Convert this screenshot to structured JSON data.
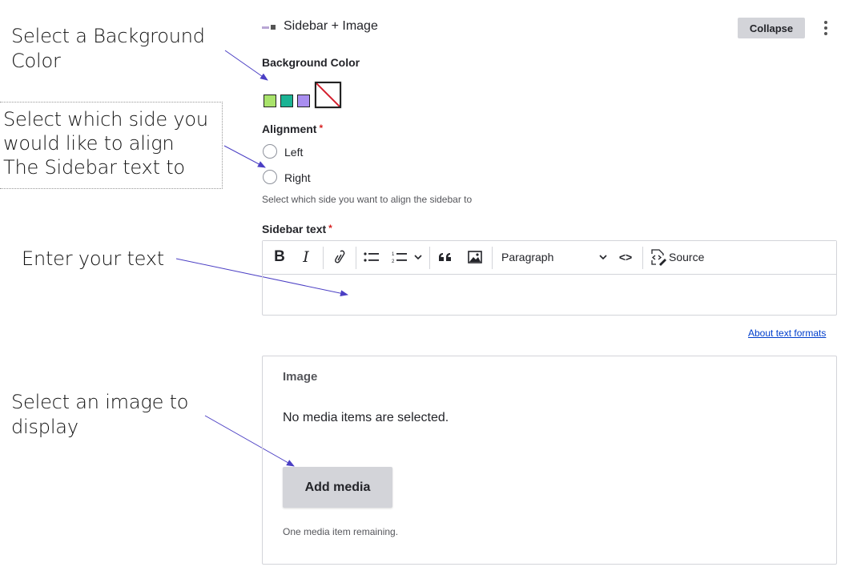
{
  "annotations": {
    "background_color": [
      "Select a Background",
      "Color"
    ],
    "alignment": [
      "Select which side you",
      "would like to align",
      "The Sidebar text to"
    ],
    "text": "Enter your text",
    "image": [
      "Select an image to",
      "display"
    ],
    "arrow_color": "#4b3fc4"
  },
  "header": {
    "icon": "paragraph-type-icon",
    "title": "Sidebar + Image",
    "collapse_label": "Collapse",
    "more_icon": "kebab-menu-icon"
  },
  "background_color": {
    "label": "Background Color",
    "swatches": [
      {
        "name": "light-green",
        "color": "#a9e36b"
      },
      {
        "name": "teal",
        "color": "#1bb394"
      },
      {
        "name": "lavender",
        "color": "#a98ef0"
      },
      {
        "name": "none",
        "color": null
      }
    ]
  },
  "alignment": {
    "label": "Alignment",
    "required_mark": "*",
    "options": [
      "Left",
      "Right"
    ],
    "selected": null,
    "help": "Select which side you want to align the sidebar to"
  },
  "sidebar_text": {
    "label": "Sidebar text",
    "required_mark": "*",
    "toolbar": {
      "bold": "B",
      "italic": "I",
      "link_icon": "link-icon",
      "bulleted_list_icon": "bulleted-list-icon",
      "numbered_list_icon": "numbered-list-icon",
      "blockquote": "“",
      "image_icon": "image-icon",
      "heading_select": "Paragraph",
      "code": "<>",
      "source": "Source"
    },
    "value": "",
    "about_formats_link": "About text formats"
  },
  "image": {
    "legend": "Image",
    "empty_message": "No media items are selected.",
    "add_media_label": "Add media",
    "remaining": "One media item remaining."
  }
}
